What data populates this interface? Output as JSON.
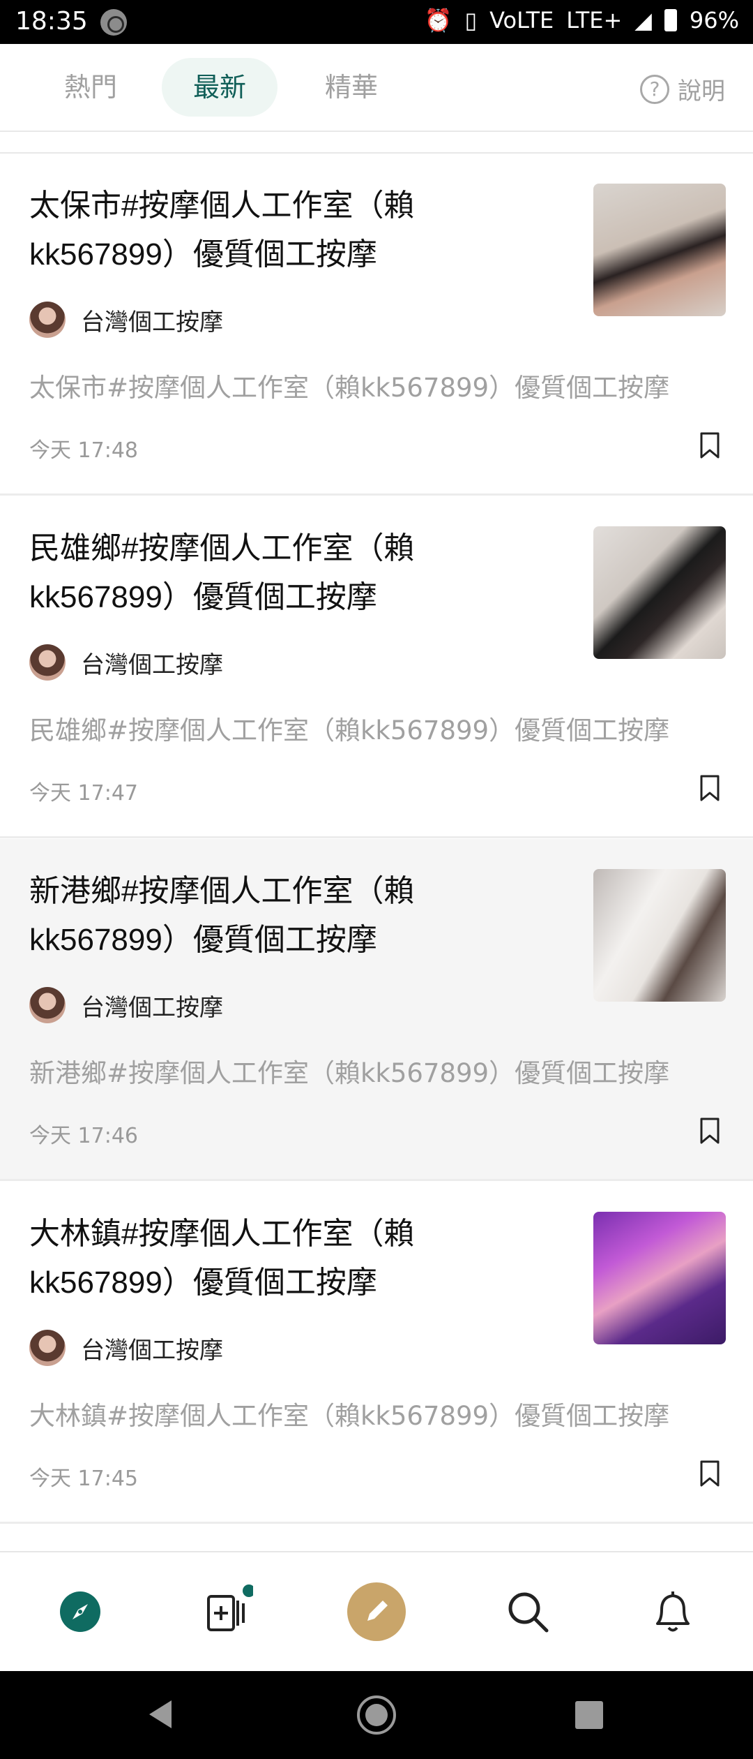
{
  "status_bar": {
    "time": "18:35",
    "network": "LTE+",
    "battery": "96%"
  },
  "tabs": [
    {
      "label": "熱門"
    },
    {
      "label": "最新"
    },
    {
      "label": "精華"
    }
  ],
  "help_label": "說明",
  "posts": [
    {
      "title": "太保市#按摩個人工作室（賴kk567899）優質個工按摩",
      "author": "台灣個工按摩",
      "excerpt": "太保市#按摩個人工作室（賴kk567899）優質個工按摩",
      "time": "今天 17:48"
    },
    {
      "title": "民雄鄉#按摩個人工作室（賴kk567899）優質個工按摩",
      "author": "台灣個工按摩",
      "excerpt": "民雄鄉#按摩個人工作室（賴kk567899）優質個工按摩",
      "time": "今天 17:47"
    },
    {
      "title": "新港鄉#按摩個人工作室（賴kk567899）優質個工按摩",
      "author": "台灣個工按摩",
      "excerpt": "新港鄉#按摩個人工作室（賴kk567899）優質個工按摩",
      "time": "今天 17:46"
    },
    {
      "title": "大林鎮#按摩個人工作室（賴kk567899）優質個工按摩",
      "author": "台灣個工按摩",
      "excerpt": "大林鎮#按摩個人工作室（賴kk567899）優質個工按摩",
      "time": "今天 17:45"
    }
  ],
  "bottom_nav": [
    "compass-icon",
    "new-post-icon",
    "pen-icon",
    "search-icon",
    "bell-icon"
  ],
  "colors": {
    "accent": "#0f6b61",
    "pen_button": "#c9a56a",
    "tab_active_bg": "#eef6f3"
  }
}
